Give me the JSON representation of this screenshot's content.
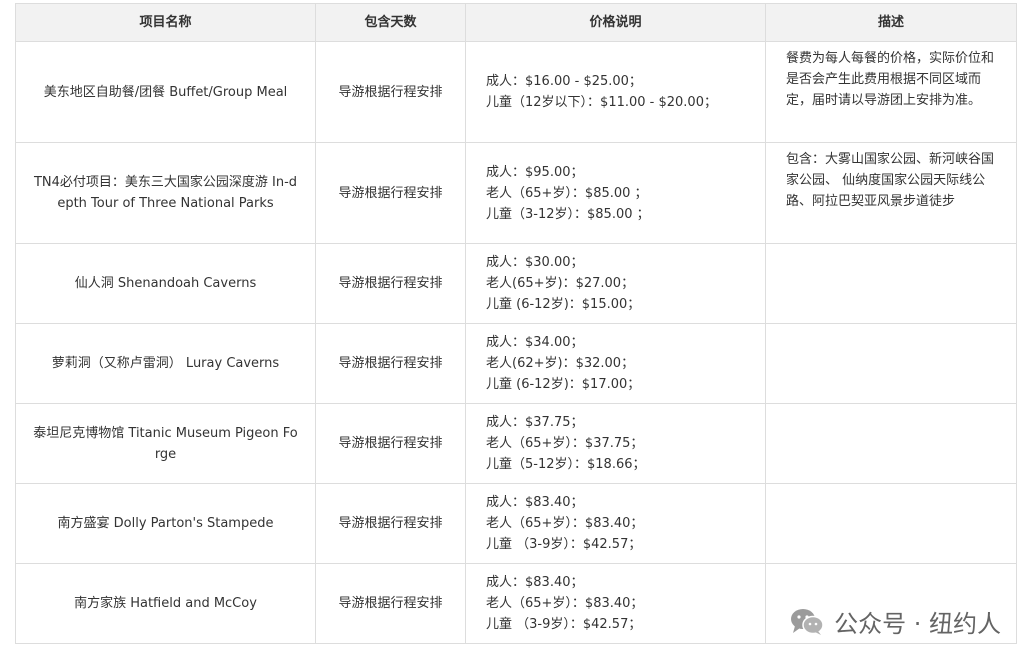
{
  "table": {
    "headers": [
      "项目名称",
      "包含天数",
      "价格说明",
      "描述"
    ],
    "rows": [
      {
        "name": "美东地区自助餐/团餐 Buffet/Group Meal",
        "days": "导游根据行程安排",
        "prices": [
          "成人：$16.00 - $25.00；",
          "儿童（12岁以下）：$11.00 - $20.00；"
        ],
        "desc": "餐费为每人每餐的价格，实际价位和是否会产生此费用根据不同区域而定，届时请以导游团上安排为准。"
      },
      {
        "name": "TN4必付项目：美东三大国家公园深度游 In-depth Tour of Three National Parks",
        "days": "导游根据行程安排",
        "prices": [
          "成人：$95.00；",
          "老人（65+岁）：$85.00 ；",
          "儿童（3-12岁）：$85.00 ；"
        ],
        "desc": "包含：大雾山国家公园、新河峡谷国家公园、 仙纳度国家公园天际线公路、阿拉巴契亚风景步道徒步"
      },
      {
        "name": "仙人洞 Shenandoah Caverns",
        "days": "导游根据行程安排",
        "prices": [
          "成人：$30.00；",
          "老人(65+岁)：$27.00；",
          "儿童 (6-12岁)：$15.00；"
        ],
        "desc": ""
      },
      {
        "name": "萝莉洞（又称卢雷洞） Luray Caverns",
        "days": "导游根据行程安排",
        "prices": [
          "成人：$34.00；",
          "老人(62+岁)：$32.00；",
          "儿童 (6-12岁)：$17.00；"
        ],
        "desc": ""
      },
      {
        "name": "泰坦尼克博物馆 Titanic Museum Pigeon Forge",
        "days": "导游根据行程安排",
        "prices": [
          "成人：$37.75；",
          "老人（65+岁）：$37.75；",
          "儿童（5-12岁）：$18.66；"
        ],
        "desc": ""
      },
      {
        "name": "南方盛宴 Dolly Parton's Stampede",
        "days": "导游根据行程安排",
        "prices": [
          "成人：$83.40；",
          "老人（65+岁）：$83.40；",
          "儿童 （3-9岁）：$42.57；"
        ],
        "desc": ""
      },
      {
        "name": "南方家族 Hatfield and McCoy",
        "days": "导游根据行程安排",
        "prices": [
          "成人：$83.40；",
          "老人（65+岁）：$83.40；",
          "儿童 （3-9岁）：$42.57；"
        ],
        "desc": ""
      }
    ]
  },
  "watermark": {
    "text": "公众号 · 纽约人",
    "icon": "wechat-icon"
  }
}
